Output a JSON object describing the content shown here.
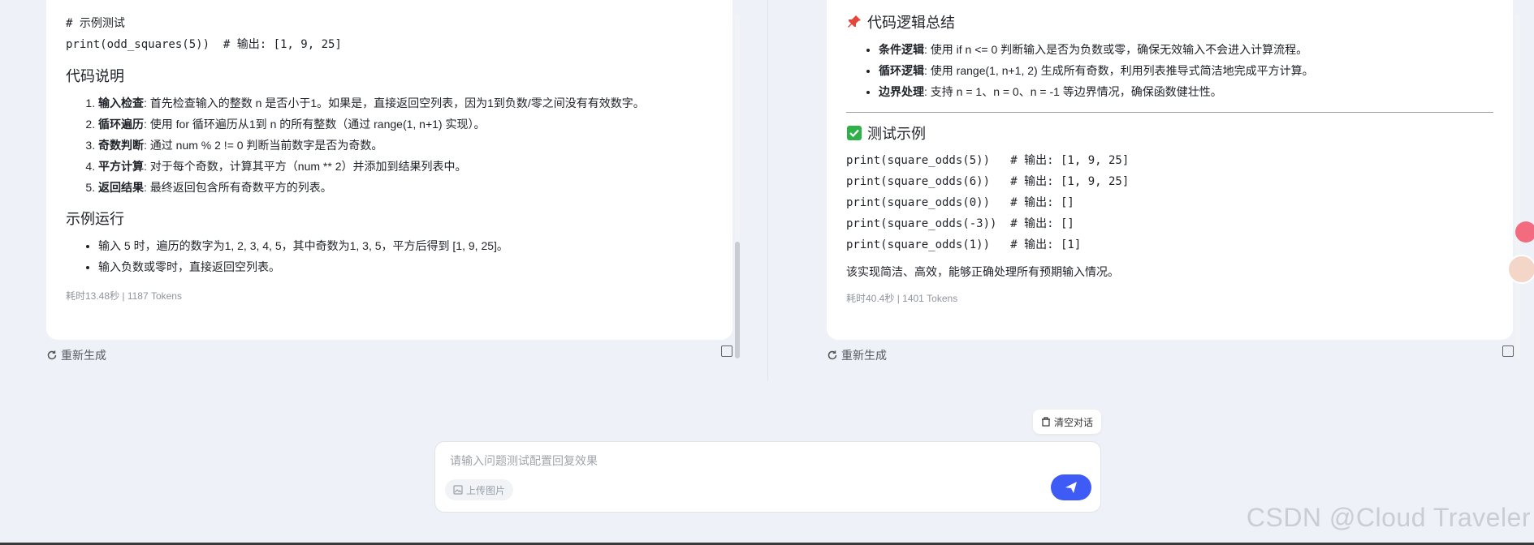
{
  "left": {
    "code_comment": "# 示例测试",
    "code_call": "print(odd_squares(5))  # 输出: [1, 9, 25]",
    "h_explain": "代码说明",
    "explain": [
      {
        "bold": "输入检查",
        "text": ": 首先检查输入的整数 n 是否小于1。如果是，直接返回空列表，因为1到负数/零之间没有有效数字。"
      },
      {
        "bold": "循环遍历",
        "text": ": 使用 for 循环遍历从1到 n 的所有整数（通过 range(1, n+1) 实现）。"
      },
      {
        "bold": "奇数判断",
        "text": ": 通过 num % 2 != 0 判断当前数字是否为奇数。"
      },
      {
        "bold": "平方计算",
        "text": ": 对于每个奇数，计算其平方（num ** 2）并添加到结果列表中。"
      },
      {
        "bold": "返回结果",
        "text": ": 最终返回包含所有奇数平方的列表。"
      }
    ],
    "h_run": "示例运行",
    "run": [
      "输入 5 时，遍历的数字为1, 2, 3, 4, 5，其中奇数为1, 3, 5，平方后得到 [1, 9, 25]。",
      "输入负数或零时，直接返回空列表。"
    ],
    "meta": "耗时13.48秒  | 1187 Tokens",
    "regen_label": "重新生成"
  },
  "right": {
    "h_logic": "代码逻辑总结",
    "logic": [
      {
        "bold": "条件逻辑",
        "text": ": 使用 if n <= 0 判断输入是否为负数或零，确保无效输入不会进入计算流程。"
      },
      {
        "bold": "循环逻辑",
        "text": ": 使用 range(1, n+1, 2) 生成所有奇数，利用列表推导式简洁地完成平方计算。"
      },
      {
        "bold": "边界处理",
        "text": ": 支持 n = 1、n = 0、n = -1 等边界情况，确保函数健壮性。"
      }
    ],
    "h_test": "测试示例",
    "tests": [
      "print(square_odds(5))   # 输出: [1, 9, 25]",
      "print(square_odds(6))   # 输出: [1, 9, 25]",
      "print(square_odds(0))   # 输出: []",
      "print(square_odds(-3))  # 输出: []",
      "print(square_odds(1))   # 输出: [1]"
    ],
    "summary": "该实现简洁、高效，能够正确处理所有预期输入情况。",
    "meta": "耗时40.4秒  | 1401 Tokens",
    "regen_label": "重新生成"
  },
  "bottom": {
    "clear_label": "清空对话",
    "input_placeholder": "请输入问题测试配置回复效果",
    "upload_label": "上传图片"
  },
  "watermark": "CSDN @Cloud Traveler",
  "colors": {
    "send_button": "#3f5bf6",
    "background": "#eef1f7"
  }
}
